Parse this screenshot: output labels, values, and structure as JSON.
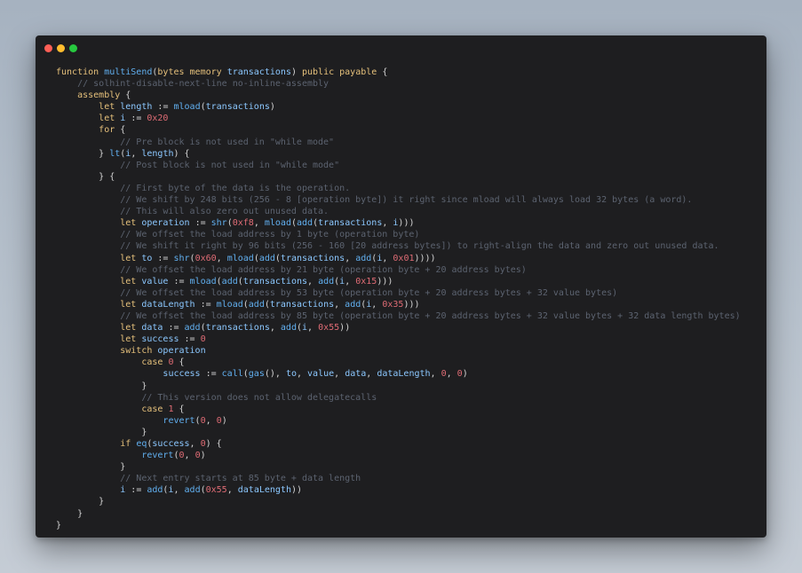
{
  "window": {
    "controls": {
      "close_color": "#ff5f56",
      "minimize_color": "#ffbd2e",
      "zoom_color": "#27c93f"
    }
  },
  "editor": {
    "lines": [
      [
        {
          "t": "function ",
          "k": "kw"
        },
        {
          "t": "multiSend",
          "k": "fn"
        },
        {
          "t": "(",
          "k": "pun"
        },
        {
          "t": "bytes ",
          "k": "kw"
        },
        {
          "t": "memory ",
          "k": "kw"
        },
        {
          "t": "transactions",
          "k": "id"
        },
        {
          "t": ") ",
          "k": "pun"
        },
        {
          "t": "public ",
          "k": "kw"
        },
        {
          "t": "payable ",
          "k": "kw"
        },
        {
          "t": "{",
          "k": "pun"
        }
      ],
      [
        {
          "t": "    ",
          "k": "pun"
        },
        {
          "t": "// solhint-disable-next-line no-inline-assembly",
          "k": "cm"
        }
      ],
      [
        {
          "t": "    ",
          "k": "pun"
        },
        {
          "t": "assembly ",
          "k": "kw"
        },
        {
          "t": "{",
          "k": "pun"
        }
      ],
      [
        {
          "t": "        ",
          "k": "pun"
        },
        {
          "t": "let ",
          "k": "kw"
        },
        {
          "t": "length ",
          "k": "id"
        },
        {
          "t": ":= ",
          "k": "pun"
        },
        {
          "t": "mload",
          "k": "fn"
        },
        {
          "t": "(",
          "k": "pun"
        },
        {
          "t": "transactions",
          "k": "id"
        },
        {
          "t": ")",
          "k": "pun"
        }
      ],
      [
        {
          "t": "        ",
          "k": "pun"
        },
        {
          "t": "let ",
          "k": "kw"
        },
        {
          "t": "i ",
          "k": "id"
        },
        {
          "t": ":= ",
          "k": "pun"
        },
        {
          "t": "0x20",
          "k": "num"
        }
      ],
      [
        {
          "t": "        ",
          "k": "pun"
        },
        {
          "t": "for ",
          "k": "kw"
        },
        {
          "t": "{",
          "k": "pun"
        }
      ],
      [
        {
          "t": "            ",
          "k": "pun"
        },
        {
          "t": "// Pre block is not used in \"while mode\"",
          "k": "cm"
        }
      ],
      [
        {
          "t": "        ",
          "k": "pun"
        },
        {
          "t": "} ",
          "k": "pun"
        },
        {
          "t": "lt",
          "k": "fn"
        },
        {
          "t": "(",
          "k": "pun"
        },
        {
          "t": "i",
          "k": "id"
        },
        {
          "t": ", ",
          "k": "pun"
        },
        {
          "t": "length",
          "k": "id"
        },
        {
          "t": ") {",
          "k": "pun"
        }
      ],
      [
        {
          "t": "            ",
          "k": "pun"
        },
        {
          "t": "// Post block is not used in \"while mode\"",
          "k": "cm"
        }
      ],
      [
        {
          "t": "        ",
          "k": "pun"
        },
        {
          "t": "} {",
          "k": "pun"
        }
      ],
      [
        {
          "t": "            ",
          "k": "pun"
        },
        {
          "t": "// First byte of the data is the operation.",
          "k": "cm"
        }
      ],
      [
        {
          "t": "            ",
          "k": "pun"
        },
        {
          "t": "// We shift by 248 bits (256 - 8 [operation byte]) it right since mload will always load 32 bytes (a word).",
          "k": "cm"
        }
      ],
      [
        {
          "t": "            ",
          "k": "pun"
        },
        {
          "t": "// This will also zero out unused data.",
          "k": "cm"
        }
      ],
      [
        {
          "t": "            ",
          "k": "pun"
        },
        {
          "t": "let ",
          "k": "kw"
        },
        {
          "t": "operation ",
          "k": "id"
        },
        {
          "t": ":= ",
          "k": "pun"
        },
        {
          "t": "shr",
          "k": "fn"
        },
        {
          "t": "(",
          "k": "pun"
        },
        {
          "t": "0xf8",
          "k": "num"
        },
        {
          "t": ", ",
          "k": "pun"
        },
        {
          "t": "mload",
          "k": "fn"
        },
        {
          "t": "(",
          "k": "pun"
        },
        {
          "t": "add",
          "k": "fn"
        },
        {
          "t": "(",
          "k": "pun"
        },
        {
          "t": "transactions",
          "k": "id"
        },
        {
          "t": ", ",
          "k": "pun"
        },
        {
          "t": "i",
          "k": "id"
        },
        {
          "t": ")))",
          "k": "pun"
        }
      ],
      [
        {
          "t": "            ",
          "k": "pun"
        },
        {
          "t": "// We offset the load address by 1 byte (operation byte)",
          "k": "cm"
        }
      ],
      [
        {
          "t": "            ",
          "k": "pun"
        },
        {
          "t": "// We shift it right by 96 bits (256 - 160 [20 address bytes]) to right-align the data and zero out unused data.",
          "k": "cm"
        }
      ],
      [
        {
          "t": "            ",
          "k": "pun"
        },
        {
          "t": "let ",
          "k": "kw"
        },
        {
          "t": "to ",
          "k": "id"
        },
        {
          "t": ":= ",
          "k": "pun"
        },
        {
          "t": "shr",
          "k": "fn"
        },
        {
          "t": "(",
          "k": "pun"
        },
        {
          "t": "0x60",
          "k": "num"
        },
        {
          "t": ", ",
          "k": "pun"
        },
        {
          "t": "mload",
          "k": "fn"
        },
        {
          "t": "(",
          "k": "pun"
        },
        {
          "t": "add",
          "k": "fn"
        },
        {
          "t": "(",
          "k": "pun"
        },
        {
          "t": "transactions",
          "k": "id"
        },
        {
          "t": ", ",
          "k": "pun"
        },
        {
          "t": "add",
          "k": "fn"
        },
        {
          "t": "(",
          "k": "pun"
        },
        {
          "t": "i",
          "k": "id"
        },
        {
          "t": ", ",
          "k": "pun"
        },
        {
          "t": "0x01",
          "k": "num"
        },
        {
          "t": "))))",
          "k": "pun"
        }
      ],
      [
        {
          "t": "            ",
          "k": "pun"
        },
        {
          "t": "// We offset the load address by 21 byte (operation byte + 20 address bytes)",
          "k": "cm"
        }
      ],
      [
        {
          "t": "            ",
          "k": "pun"
        },
        {
          "t": "let ",
          "k": "kw"
        },
        {
          "t": "value ",
          "k": "id"
        },
        {
          "t": ":= ",
          "k": "pun"
        },
        {
          "t": "mload",
          "k": "fn"
        },
        {
          "t": "(",
          "k": "pun"
        },
        {
          "t": "add",
          "k": "fn"
        },
        {
          "t": "(",
          "k": "pun"
        },
        {
          "t": "transactions",
          "k": "id"
        },
        {
          "t": ", ",
          "k": "pun"
        },
        {
          "t": "add",
          "k": "fn"
        },
        {
          "t": "(",
          "k": "pun"
        },
        {
          "t": "i",
          "k": "id"
        },
        {
          "t": ", ",
          "k": "pun"
        },
        {
          "t": "0x15",
          "k": "num"
        },
        {
          "t": ")))",
          "k": "pun"
        }
      ],
      [
        {
          "t": "            ",
          "k": "pun"
        },
        {
          "t": "// We offset the load address by 53 byte (operation byte + 20 address bytes + 32 value bytes)",
          "k": "cm"
        }
      ],
      [
        {
          "t": "            ",
          "k": "pun"
        },
        {
          "t": "let ",
          "k": "kw"
        },
        {
          "t": "dataLength ",
          "k": "id"
        },
        {
          "t": ":= ",
          "k": "pun"
        },
        {
          "t": "mload",
          "k": "fn"
        },
        {
          "t": "(",
          "k": "pun"
        },
        {
          "t": "add",
          "k": "fn"
        },
        {
          "t": "(",
          "k": "pun"
        },
        {
          "t": "transactions",
          "k": "id"
        },
        {
          "t": ", ",
          "k": "pun"
        },
        {
          "t": "add",
          "k": "fn"
        },
        {
          "t": "(",
          "k": "pun"
        },
        {
          "t": "i",
          "k": "id"
        },
        {
          "t": ", ",
          "k": "pun"
        },
        {
          "t": "0x35",
          "k": "num"
        },
        {
          "t": ")))",
          "k": "pun"
        }
      ],
      [
        {
          "t": "            ",
          "k": "pun"
        },
        {
          "t": "// We offset the load address by 85 byte (operation byte + 20 address bytes + 32 value bytes + 32 data length bytes)",
          "k": "cm"
        }
      ],
      [
        {
          "t": "            ",
          "k": "pun"
        },
        {
          "t": "let ",
          "k": "kw"
        },
        {
          "t": "data ",
          "k": "id"
        },
        {
          "t": ":= ",
          "k": "pun"
        },
        {
          "t": "add",
          "k": "fn"
        },
        {
          "t": "(",
          "k": "pun"
        },
        {
          "t": "transactions",
          "k": "id"
        },
        {
          "t": ", ",
          "k": "pun"
        },
        {
          "t": "add",
          "k": "fn"
        },
        {
          "t": "(",
          "k": "pun"
        },
        {
          "t": "i",
          "k": "id"
        },
        {
          "t": ", ",
          "k": "pun"
        },
        {
          "t": "0x55",
          "k": "num"
        },
        {
          "t": "))",
          "k": "pun"
        }
      ],
      [
        {
          "t": "            ",
          "k": "pun"
        },
        {
          "t": "let ",
          "k": "kw"
        },
        {
          "t": "success ",
          "k": "id"
        },
        {
          "t": ":= ",
          "k": "pun"
        },
        {
          "t": "0",
          "k": "num"
        }
      ],
      [
        {
          "t": "            ",
          "k": "pun"
        },
        {
          "t": "switch ",
          "k": "kw"
        },
        {
          "t": "operation",
          "k": "id"
        }
      ],
      [
        {
          "t": "                ",
          "k": "pun"
        },
        {
          "t": "case ",
          "k": "kw"
        },
        {
          "t": "0",
          "k": "num"
        },
        {
          "t": " {",
          "k": "pun"
        }
      ],
      [
        {
          "t": "                    ",
          "k": "pun"
        },
        {
          "t": "success ",
          "k": "id"
        },
        {
          "t": ":= ",
          "k": "pun"
        },
        {
          "t": "call",
          "k": "fn"
        },
        {
          "t": "(",
          "k": "pun"
        },
        {
          "t": "gas",
          "k": "fn"
        },
        {
          "t": "(), ",
          "k": "pun"
        },
        {
          "t": "to",
          "k": "id"
        },
        {
          "t": ", ",
          "k": "pun"
        },
        {
          "t": "value",
          "k": "id"
        },
        {
          "t": ", ",
          "k": "pun"
        },
        {
          "t": "data",
          "k": "id"
        },
        {
          "t": ", ",
          "k": "pun"
        },
        {
          "t": "dataLength",
          "k": "id"
        },
        {
          "t": ", ",
          "k": "pun"
        },
        {
          "t": "0",
          "k": "num"
        },
        {
          "t": ", ",
          "k": "pun"
        },
        {
          "t": "0",
          "k": "num"
        },
        {
          "t": ")",
          "k": "pun"
        }
      ],
      [
        {
          "t": "                ",
          "k": "pun"
        },
        {
          "t": "}",
          "k": "pun"
        }
      ],
      [
        {
          "t": "                ",
          "k": "pun"
        },
        {
          "t": "// This version does not allow delegatecalls",
          "k": "cm"
        }
      ],
      [
        {
          "t": "                ",
          "k": "pun"
        },
        {
          "t": "case ",
          "k": "kw"
        },
        {
          "t": "1",
          "k": "num"
        },
        {
          "t": " {",
          "k": "pun"
        }
      ],
      [
        {
          "t": "                    ",
          "k": "pun"
        },
        {
          "t": "revert",
          "k": "fn"
        },
        {
          "t": "(",
          "k": "pun"
        },
        {
          "t": "0",
          "k": "num"
        },
        {
          "t": ", ",
          "k": "pun"
        },
        {
          "t": "0",
          "k": "num"
        },
        {
          "t": ")",
          "k": "pun"
        }
      ],
      [
        {
          "t": "                ",
          "k": "pun"
        },
        {
          "t": "}",
          "k": "pun"
        }
      ],
      [
        {
          "t": "            ",
          "k": "pun"
        },
        {
          "t": "if ",
          "k": "kw"
        },
        {
          "t": "eq",
          "k": "fn"
        },
        {
          "t": "(",
          "k": "pun"
        },
        {
          "t": "success",
          "k": "id"
        },
        {
          "t": ", ",
          "k": "pun"
        },
        {
          "t": "0",
          "k": "num"
        },
        {
          "t": ") {",
          "k": "pun"
        }
      ],
      [
        {
          "t": "                ",
          "k": "pun"
        },
        {
          "t": "revert",
          "k": "fn"
        },
        {
          "t": "(",
          "k": "pun"
        },
        {
          "t": "0",
          "k": "num"
        },
        {
          "t": ", ",
          "k": "pun"
        },
        {
          "t": "0",
          "k": "num"
        },
        {
          "t": ")",
          "k": "pun"
        }
      ],
      [
        {
          "t": "            ",
          "k": "pun"
        },
        {
          "t": "}",
          "k": "pun"
        }
      ],
      [
        {
          "t": "            ",
          "k": "pun"
        },
        {
          "t": "// Next entry starts at 85 byte + data length",
          "k": "cm"
        }
      ],
      [
        {
          "t": "            ",
          "k": "pun"
        },
        {
          "t": "i ",
          "k": "id"
        },
        {
          "t": ":= ",
          "k": "pun"
        },
        {
          "t": "add",
          "k": "fn"
        },
        {
          "t": "(",
          "k": "pun"
        },
        {
          "t": "i",
          "k": "id"
        },
        {
          "t": ", ",
          "k": "pun"
        },
        {
          "t": "add",
          "k": "fn"
        },
        {
          "t": "(",
          "k": "pun"
        },
        {
          "t": "0x55",
          "k": "num"
        },
        {
          "t": ", ",
          "k": "pun"
        },
        {
          "t": "dataLength",
          "k": "id"
        },
        {
          "t": "))",
          "k": "pun"
        }
      ],
      [
        {
          "t": "        ",
          "k": "pun"
        },
        {
          "t": "}",
          "k": "pun"
        }
      ],
      [
        {
          "t": "    ",
          "k": "pun"
        },
        {
          "t": "}",
          "k": "pun"
        }
      ],
      [
        {
          "t": "}",
          "k": "pun"
        }
      ]
    ]
  }
}
